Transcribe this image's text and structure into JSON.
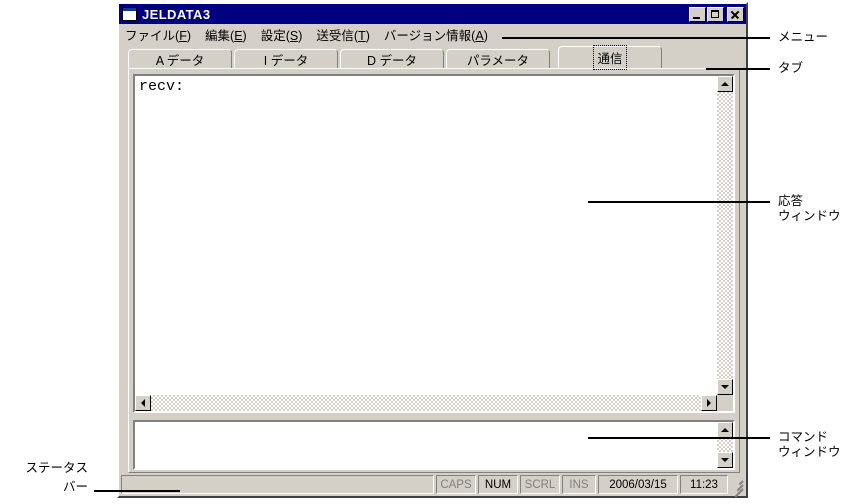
{
  "window": {
    "title": "JELDATA3",
    "icon": "window-icon",
    "controls": {
      "minimize": "minimize-icon",
      "maximize": "maximize-icon",
      "close": "close-icon"
    }
  },
  "menu": {
    "items": [
      {
        "label": "ファイル",
        "accel": "F"
      },
      {
        "label": "編集",
        "accel": "E"
      },
      {
        "label": "設定",
        "accel": "S"
      },
      {
        "label": "送受信",
        "accel": "T"
      },
      {
        "label": "バージョン情報",
        "accel": "A"
      }
    ]
  },
  "tabs": [
    {
      "label": "A データ",
      "active": false
    },
    {
      "label": "I データ",
      "active": false
    },
    {
      "label": "D データ",
      "active": false
    },
    {
      "label": "パラメータ",
      "active": false
    },
    {
      "label": "通信",
      "active": true
    }
  ],
  "response_window": {
    "text": "recv:",
    "scroll_up": "scroll-up-arrow",
    "scroll_down": "scroll-down-arrow",
    "scroll_left": "scroll-left-arrow",
    "scroll_right": "scroll-right-arrow"
  },
  "command_window": {
    "text": "",
    "placeholder": ""
  },
  "status_bar": {
    "message": "",
    "indicators": [
      {
        "label": "CAPS",
        "active": false
      },
      {
        "label": "NUM",
        "active": true
      },
      {
        "label": "SCRL",
        "active": false
      },
      {
        "label": "INS",
        "active": false
      }
    ],
    "date": "2006/03/15",
    "time": "11:23"
  },
  "annotations": {
    "menu": "メニュー",
    "tab": "タブ",
    "response_window_line1": "応答",
    "response_window_line2": "ウィンドウ",
    "command_window_line1": "コマンド",
    "command_window_line2": "ウィンドウ",
    "status_bar_line1": "ステータス",
    "status_bar_line2": "バー"
  },
  "colors": {
    "title_bar": "#000080",
    "face": "#d4d0c8",
    "client": "#ffffff",
    "shadow": "#808080",
    "dark": "#404040",
    "text": "#000000",
    "disabled_text": "#808080"
  }
}
